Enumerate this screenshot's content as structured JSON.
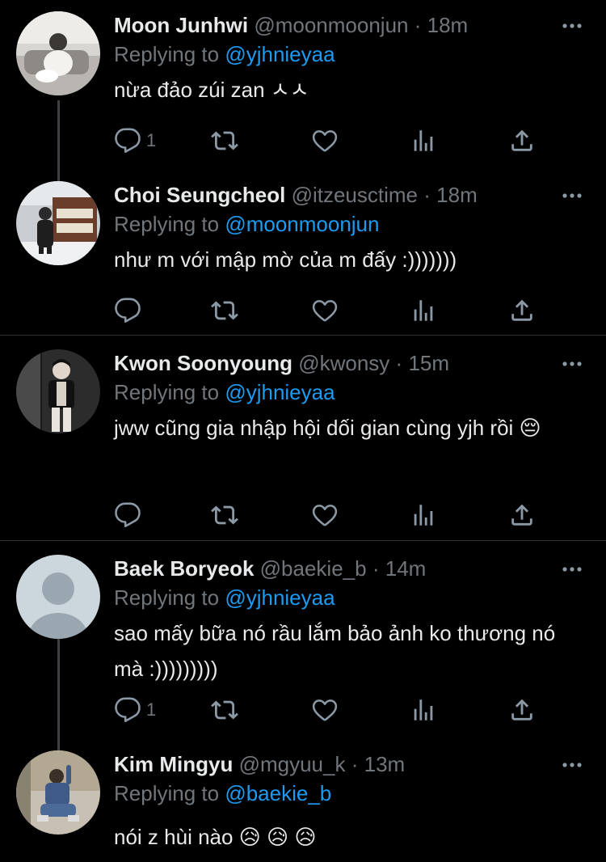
{
  "colors": {
    "background": "#000000",
    "text": "#e7e9ea",
    "muted": "#71767b",
    "link": "#1d9bf0",
    "divider": "#2f3336"
  },
  "icons": {
    "reply": "speech-bubble-icon",
    "retweet": "retweet-arrows-icon",
    "like": "heart-icon",
    "views": "bar-chart-icon",
    "share": "upload-arrow-icon",
    "more": "three-dots-icon"
  },
  "tweets": [
    {
      "name": "Moon Junhwi",
      "handle": "@moonmoonjun",
      "separator": "·",
      "time": "18m",
      "replying_prefix": "Replying to",
      "replying_to": "@yjhnieyaa",
      "text": "nừa đảo zúi zan ㅅㅅ",
      "reply_count": "1"
    },
    {
      "name": "Choi Seungcheol",
      "handle": "@itzeusctime",
      "separator": "·",
      "time": "18m",
      "replying_prefix": "Replying to",
      "replying_to": "@moonmoonjun",
      "text": "như m với mập mờ của m đấy :)))))))",
      "reply_count": ""
    },
    {
      "name": "Kwon Soonyoung",
      "handle": "@kwonsy",
      "separator": "·",
      "time": "15m",
      "replying_prefix": "Replying to",
      "replying_to": "@yjhnieyaa",
      "text": "jww cũng gia nhập hội dối gian cùng yjh rồi 😔",
      "reply_count": ""
    },
    {
      "name": "Baek Boryeok",
      "handle": "@baekie_b",
      "separator": "·",
      "time": "14m",
      "replying_prefix": "Replying to",
      "replying_to": "@yjhnieyaa",
      "text": "sao mấy bữa nó rầu lắm bảo ảnh ko thương nó mà :)))))))))",
      "reply_count": "1"
    },
    {
      "name": "Kim Mingyu",
      "handle": "@mgyuu_k",
      "separator": "·",
      "time": "13m",
      "replying_prefix": "Replying to",
      "replying_to": "@baekie_b",
      "text": "nói z hùi nào 😥 😥 😥",
      "reply_count": ""
    }
  ]
}
